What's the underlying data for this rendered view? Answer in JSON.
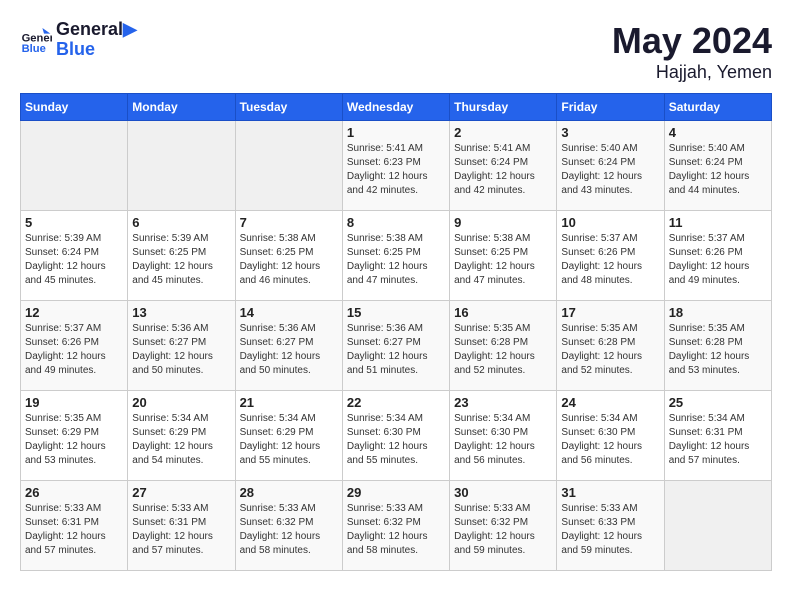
{
  "header": {
    "logo_line1": "General",
    "logo_line2": "Blue",
    "month_year": "May 2024",
    "location": "Hajjah, Yemen"
  },
  "weekdays": [
    "Sunday",
    "Monday",
    "Tuesday",
    "Wednesday",
    "Thursday",
    "Friday",
    "Saturday"
  ],
  "weeks": [
    [
      {
        "day": "",
        "info": ""
      },
      {
        "day": "",
        "info": ""
      },
      {
        "day": "",
        "info": ""
      },
      {
        "day": "1",
        "info": "Sunrise: 5:41 AM\nSunset: 6:23 PM\nDaylight: 12 hours\nand 42 minutes."
      },
      {
        "day": "2",
        "info": "Sunrise: 5:41 AM\nSunset: 6:24 PM\nDaylight: 12 hours\nand 42 minutes."
      },
      {
        "day": "3",
        "info": "Sunrise: 5:40 AM\nSunset: 6:24 PM\nDaylight: 12 hours\nand 43 minutes."
      },
      {
        "day": "4",
        "info": "Sunrise: 5:40 AM\nSunset: 6:24 PM\nDaylight: 12 hours\nand 44 minutes."
      }
    ],
    [
      {
        "day": "5",
        "info": "Sunrise: 5:39 AM\nSunset: 6:24 PM\nDaylight: 12 hours\nand 45 minutes."
      },
      {
        "day": "6",
        "info": "Sunrise: 5:39 AM\nSunset: 6:25 PM\nDaylight: 12 hours\nand 45 minutes."
      },
      {
        "day": "7",
        "info": "Sunrise: 5:38 AM\nSunset: 6:25 PM\nDaylight: 12 hours\nand 46 minutes."
      },
      {
        "day": "8",
        "info": "Sunrise: 5:38 AM\nSunset: 6:25 PM\nDaylight: 12 hours\nand 47 minutes."
      },
      {
        "day": "9",
        "info": "Sunrise: 5:38 AM\nSunset: 6:25 PM\nDaylight: 12 hours\nand 47 minutes."
      },
      {
        "day": "10",
        "info": "Sunrise: 5:37 AM\nSunset: 6:26 PM\nDaylight: 12 hours\nand 48 minutes."
      },
      {
        "day": "11",
        "info": "Sunrise: 5:37 AM\nSunset: 6:26 PM\nDaylight: 12 hours\nand 49 minutes."
      }
    ],
    [
      {
        "day": "12",
        "info": "Sunrise: 5:37 AM\nSunset: 6:26 PM\nDaylight: 12 hours\nand 49 minutes."
      },
      {
        "day": "13",
        "info": "Sunrise: 5:36 AM\nSunset: 6:27 PM\nDaylight: 12 hours\nand 50 minutes."
      },
      {
        "day": "14",
        "info": "Sunrise: 5:36 AM\nSunset: 6:27 PM\nDaylight: 12 hours\nand 50 minutes."
      },
      {
        "day": "15",
        "info": "Sunrise: 5:36 AM\nSunset: 6:27 PM\nDaylight: 12 hours\nand 51 minutes."
      },
      {
        "day": "16",
        "info": "Sunrise: 5:35 AM\nSunset: 6:28 PM\nDaylight: 12 hours\nand 52 minutes."
      },
      {
        "day": "17",
        "info": "Sunrise: 5:35 AM\nSunset: 6:28 PM\nDaylight: 12 hours\nand 52 minutes."
      },
      {
        "day": "18",
        "info": "Sunrise: 5:35 AM\nSunset: 6:28 PM\nDaylight: 12 hours\nand 53 minutes."
      }
    ],
    [
      {
        "day": "19",
        "info": "Sunrise: 5:35 AM\nSunset: 6:29 PM\nDaylight: 12 hours\nand 53 minutes."
      },
      {
        "day": "20",
        "info": "Sunrise: 5:34 AM\nSunset: 6:29 PM\nDaylight: 12 hours\nand 54 minutes."
      },
      {
        "day": "21",
        "info": "Sunrise: 5:34 AM\nSunset: 6:29 PM\nDaylight: 12 hours\nand 55 minutes."
      },
      {
        "day": "22",
        "info": "Sunrise: 5:34 AM\nSunset: 6:30 PM\nDaylight: 12 hours\nand 55 minutes."
      },
      {
        "day": "23",
        "info": "Sunrise: 5:34 AM\nSunset: 6:30 PM\nDaylight: 12 hours\nand 56 minutes."
      },
      {
        "day": "24",
        "info": "Sunrise: 5:34 AM\nSunset: 6:30 PM\nDaylight: 12 hours\nand 56 minutes."
      },
      {
        "day": "25",
        "info": "Sunrise: 5:34 AM\nSunset: 6:31 PM\nDaylight: 12 hours\nand 57 minutes."
      }
    ],
    [
      {
        "day": "26",
        "info": "Sunrise: 5:33 AM\nSunset: 6:31 PM\nDaylight: 12 hours\nand 57 minutes."
      },
      {
        "day": "27",
        "info": "Sunrise: 5:33 AM\nSunset: 6:31 PM\nDaylight: 12 hours\nand 57 minutes."
      },
      {
        "day": "28",
        "info": "Sunrise: 5:33 AM\nSunset: 6:32 PM\nDaylight: 12 hours\nand 58 minutes."
      },
      {
        "day": "29",
        "info": "Sunrise: 5:33 AM\nSunset: 6:32 PM\nDaylight: 12 hours\nand 58 minutes."
      },
      {
        "day": "30",
        "info": "Sunrise: 5:33 AM\nSunset: 6:32 PM\nDaylight: 12 hours\nand 59 minutes."
      },
      {
        "day": "31",
        "info": "Sunrise: 5:33 AM\nSunset: 6:33 PM\nDaylight: 12 hours\nand 59 minutes."
      },
      {
        "day": "",
        "info": ""
      }
    ]
  ]
}
